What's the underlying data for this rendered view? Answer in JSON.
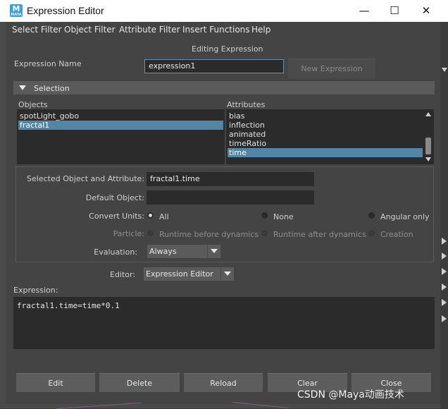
{
  "window": {
    "title": "Expression Editor",
    "app_icon_letter": "M",
    "app_icon_sub": "MAYA",
    "minimize_glyph": "—",
    "maximize_glyph": "☐",
    "close_glyph": "✕"
  },
  "menu": [
    "Select Filter",
    "Object Filter",
    "Attribute Filter",
    "Insert Functions",
    "Help"
  ],
  "header": {
    "mode_label": "Editing Expression",
    "expression_name_label": "Expression Name",
    "expression_name_value": "expression1",
    "new_expression_button": "New Expression"
  },
  "selection": {
    "section_title": "Selection",
    "objects_label": "Objects",
    "attributes_label": "Attributes",
    "objects": [
      "spotLight_gobo",
      "fractal1"
    ],
    "objects_selected_index": 1,
    "attributes": [
      "bias",
      "inflection",
      "animated",
      "timeRatio",
      "time"
    ],
    "attributes_selected_index": 4
  },
  "details": {
    "selected_label": "Selected Object and Attribute:",
    "selected_value": "fractal1.time",
    "default_object_label": "Default Object:",
    "default_object_value": "",
    "convert_units_label": "Convert Units:",
    "convert_units_options": [
      "All",
      "None",
      "Angular only"
    ],
    "convert_units_selected": "All",
    "particle_label": "Particle:",
    "particle_options": [
      "Runtime before dynamics",
      "Runtime after dynamics",
      "Creation"
    ],
    "evaluation_label": "Evaluation:",
    "evaluation_value": "Always"
  },
  "editor": {
    "label": "Editor:",
    "value": "Expression Editor",
    "expression_label": "Expression:",
    "expression_text": "fractal1.time=time*0.1"
  },
  "buttons": [
    "Edit",
    "Delete",
    "Reload",
    "Clear",
    "Close"
  ],
  "watermark": "CSDN @Maya动画技术",
  "colors": {
    "selection_highlight": "#5285a6",
    "panel_bg": "#444444",
    "field_bg": "#2b2b2b"
  }
}
